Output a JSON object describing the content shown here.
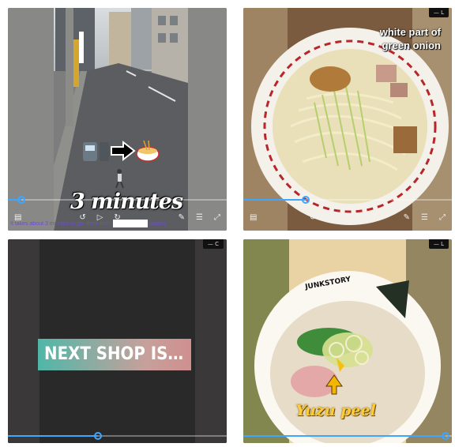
{
  "panels": {
    "street": {
      "caption": "3 minutes",
      "subtitle": "It takes about 3 minutes to get there from",
      "subtitle_tail": "station.",
      "progress": 0.06,
      "controls": [
        "comment-icon",
        "prev-icon",
        "play-icon",
        "next-icon",
        "edit-icon",
        "menu-icon",
        "fullscreen-icon"
      ]
    },
    "noodles": {
      "label_line1": "white part of",
      "label_line2": "green onion",
      "badge": "— L",
      "progress": 0.3,
      "controls": [
        "comment-icon",
        "prev-icon",
        "play-icon",
        "next-icon",
        "edit-icon",
        "menu-icon",
        "fullscreen-icon"
      ]
    },
    "next_shop": {
      "title": "NEXT SHOP IS…",
      "badge": "— C",
      "progress": 0.41
    },
    "ramen": {
      "bowl_text": "JUNKSTORY",
      "label": "Yuzu peel",
      "badge": "— L",
      "progress": 0.97
    }
  },
  "colors": {
    "accent": "#3ea6ff",
    "subtitle": "#6f4dd6",
    "next_shop_left": "#4fb7a8",
    "next_shop_right": "#cf8f8f",
    "yuzu": "#ffcc33"
  }
}
